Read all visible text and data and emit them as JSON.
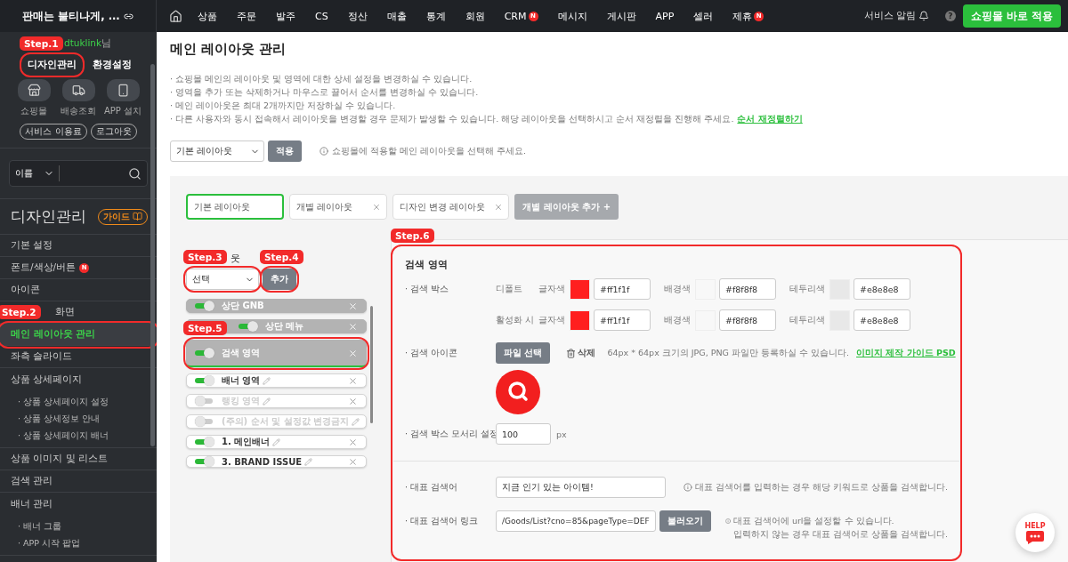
{
  "brand": {
    "title": "판매는 불티나게, ..."
  },
  "nav": {
    "items": [
      {
        "label": "상품"
      },
      {
        "label": "주문"
      },
      {
        "label": "발주"
      },
      {
        "label": "CS"
      },
      {
        "label": "정산"
      },
      {
        "label": "매출"
      },
      {
        "label": "통계"
      },
      {
        "label": "회원"
      },
      {
        "label": "CRM",
        "badge": "N"
      },
      {
        "label": "메시지"
      },
      {
        "label": "게시판"
      },
      {
        "label": "APP"
      },
      {
        "label": "셀러"
      },
      {
        "label": "제휴",
        "badge": "N"
      }
    ],
    "notifications": "서비스 알림",
    "help": "?",
    "apply_button": "쇼핑몰 바로 적용"
  },
  "sidebar": {
    "user": {
      "name": "dtuklink",
      "suffix": "님"
    },
    "tabs": [
      {
        "label": "디자인관리",
        "step": "Step.1"
      },
      {
        "label": "환경설정"
      }
    ],
    "shortcuts": [
      {
        "kind": "store",
        "label": "쇼핑몰"
      },
      {
        "kind": "truck",
        "label": "배송조회"
      },
      {
        "kind": "phone",
        "label": "APP 설치"
      }
    ],
    "pills": [
      "서비스 이용료",
      "로그아웃"
    ],
    "search": {
      "filter": "이름"
    },
    "section_title": "디자인관리",
    "guide_button": "가이드",
    "menu": [
      {
        "label": "기본 설정",
        "selected": false
      },
      {
        "label": "폰트/색상/버튼",
        "badge": "N",
        "selected": false
      },
      {
        "label": "아이콘",
        "selected": false
      },
      {
        "label": "화면",
        "selected": false
      },
      {
        "label": "메인 레이아웃 관리",
        "selected": true,
        "step": "Step.2"
      },
      {
        "label": "좌측 슬라이드",
        "selected": false
      },
      {
        "label": "상품 상세페이지",
        "selected": false,
        "children": [
          {
            "label": "· 상품 상세페이지 설정"
          },
          {
            "label": "· 상품 상세정보 안내"
          },
          {
            "label": "· 상품 상세페이지 배너"
          }
        ]
      },
      {
        "label": "상품 이미지 및 리스트",
        "selected": false
      },
      {
        "label": "검색 관리",
        "selected": false
      },
      {
        "label": "배너 관리",
        "selected": false,
        "children": [
          {
            "label": "· 배너 그룹"
          },
          {
            "label": "· APP 시작 팝업"
          }
        ]
      }
    ]
  },
  "main": {
    "title": "메인 레이아웃 관리",
    "notes": [
      "· 쇼핑몰 메인의 레이아웃 및 영역에 대한 상세 설정을 변경하실 수 있습니다.",
      "· 영역을 추가 또는 삭제하거나 마우스로 끌어서 순서를 변경하실 수 있습니다.",
      "· 메인 레이아웃은 최대 2개까지만 저장하실 수 있습니다.",
      "· 다른 사용자와 동시 접속해서 레이아웃을 변경할 경우 문제가 발생할 수 있습니다. 해당 레이아웃을 선택하시고 순서 재정렬을 진행해 주세요."
    ],
    "reorder_link": "순서 재정렬하기",
    "layout_select": "기본 레이아웃",
    "apply_button": "적용",
    "hint": "쇼핑몰에 적용할 메인 레이아웃을 선택해 주세요."
  },
  "layouts": {
    "tabs": [
      {
        "label": "기본 레이아웃",
        "selected": true,
        "closable": false
      },
      {
        "label": "개별 레이아웃",
        "selected": false,
        "closable": true
      },
      {
        "label": "디자인 변경 레이아웃",
        "selected": false,
        "closable": true
      }
    ],
    "add_button": "개별 레이아웃 추가 +"
  },
  "areas": {
    "label": "웃",
    "select": {
      "value": "선택",
      "step": "Step.3"
    },
    "add_button": {
      "label": "추가",
      "step": "Step.4"
    },
    "items": [
      {
        "kind": "fixed",
        "label": "상단 GNB",
        "on": true,
        "selected": false
      },
      {
        "kind": "fixed",
        "label": "상단 메뉴",
        "on": true,
        "selected": false
      },
      {
        "kind": "fixed",
        "label": "검색 영역",
        "on": true,
        "selected": true,
        "step": "Step.5"
      },
      {
        "kind": "custom",
        "label": "배너 영역",
        "on": true,
        "selected": false
      },
      {
        "kind": "custom",
        "label": "랭킹 영역",
        "on": false,
        "selected": false
      },
      {
        "kind": "custom",
        "label": "(주의) 순서 및 설정값 변경금지",
        "on": false,
        "selected": false
      },
      {
        "kind": "custom",
        "label": "1. 메인배너",
        "on": true,
        "selected": false
      },
      {
        "kind": "custom",
        "label": "3. BRAND ISSUE",
        "on": true,
        "selected": false
      }
    ]
  },
  "detail": {
    "title": "검색 영역",
    "step": "Step.6",
    "search_box": {
      "label": "· 검색 박스",
      "states": [
        {
          "label": "디폴트",
          "colors": [
            {
              "label": "글자색",
              "value": "#ff1f1f",
              "color": "#ff1f1f"
            },
            {
              "label": "배경색",
              "value": "#f8f8f8",
              "color": "#f8f8f8"
            },
            {
              "label": "테두리색",
              "value": "#e8e8e8",
              "color": "#e8e8e8"
            }
          ]
        },
        {
          "label": "활성화 시",
          "colors": [
            {
              "label": "글자색",
              "value": "#ff1f1f",
              "color": "#ff1f1f"
            },
            {
              "label": "배경색",
              "value": "#f8f8f8",
              "color": "#f8f8f8"
            },
            {
              "label": "테두리색",
              "value": "#e8e8e8",
              "color": "#e8e8e8"
            }
          ]
        }
      ]
    },
    "icon": {
      "label": "· 검색 아이콘",
      "file_button": "파일 선택",
      "delete_button": "삭제",
      "hint": "64px * 64px 크기의 JPG, PNG 파일만 등록하실 수 있습니다.",
      "guide_link": "이미지 제작 가이드 PSD"
    },
    "radius": {
      "label": "· 검색 박스 모서리 설정",
      "value": "100",
      "unit": "px"
    },
    "keyword": {
      "label": "· 대표 검색어",
      "value": "지금 인기 있는 아이템!",
      "hint": "대표 검색어를 입력하는 경우 해당 키워드로 상품을 검색합니다."
    },
    "link": {
      "label": "· 대표 검색어 링크",
      "value": "/Goods/List?cno=85&pageType=DEF",
      "button": "불러오기",
      "hints": [
        "대표 검색어에 url을 설정할 수 있습니다.",
        "입력하지 않는 경우 대표 검색어로 상품을 검색합니다."
      ]
    }
  },
  "help": {
    "label": "HELP"
  }
}
